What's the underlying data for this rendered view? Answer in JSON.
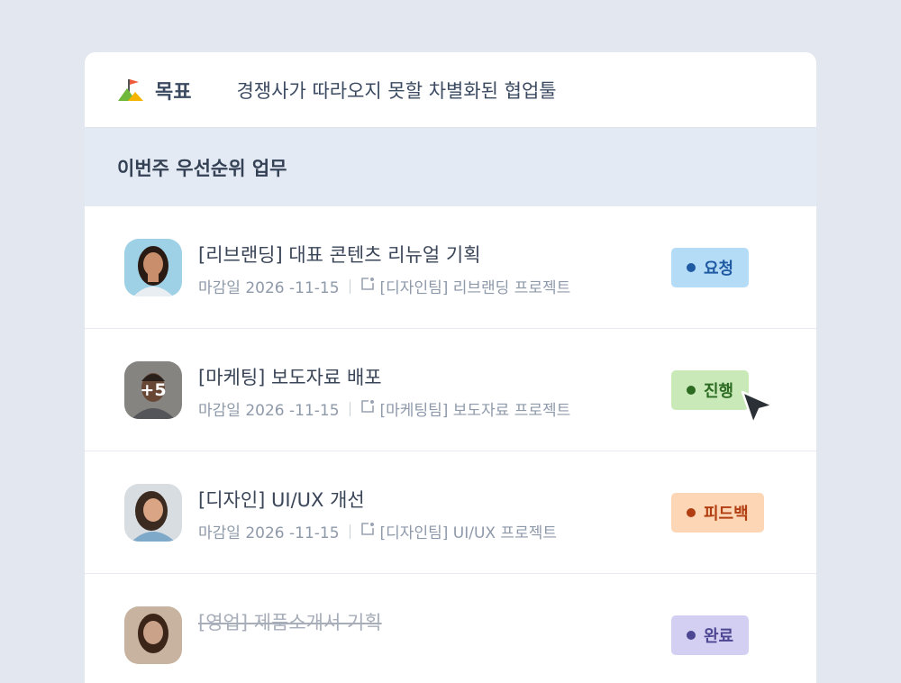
{
  "goal": {
    "label": "목표",
    "text": "경쟁사가 따라오지 못할 차별화된 협업툴"
  },
  "section": {
    "title": "이번주 우선순위 업무"
  },
  "tasks": [
    {
      "title": "[리브랜딩] 대표 콘텐츠 리뉴얼 기획",
      "due": "마감일 2026 -11-15",
      "project": "[디자인팀] 리브랜딩 프로젝트",
      "status": "요청"
    },
    {
      "title": "[마케팅] 보도자료 배포",
      "due": "마감일 2026 -11-15",
      "project": "[마케팅팀] 보도자료 프로젝트",
      "status": "진행",
      "avatar_extra": "+5"
    },
    {
      "title": "[디자인] UI/UX 개선",
      "due": "마감일 2026 -11-15",
      "project": "[디자인팀] UI/UX 프로젝트",
      "status": "피드백"
    },
    {
      "title": "[영업] 제품소개서 기획",
      "status": "완료"
    }
  ],
  "colors": {
    "request": "#b4dcf7",
    "progress": "#c9e9b8",
    "feedback": "#fdd7b5",
    "done": "#d3cff2"
  },
  "icons": [
    "goal-flag-icon",
    "project-icon",
    "mouse-cursor-icon"
  ]
}
